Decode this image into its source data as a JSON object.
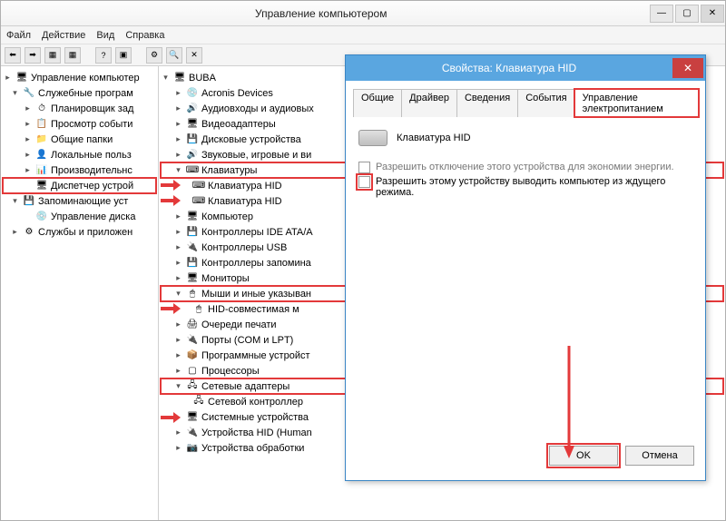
{
  "window": {
    "title": "Управление компьютером",
    "btn_min": "—",
    "btn_max": "▢",
    "btn_close": "✕"
  },
  "menu": {
    "file": "Файл",
    "action": "Действие",
    "view": "Вид",
    "help": "Справка"
  },
  "left_tree": {
    "root": "Управление компьютер",
    "n1": "Служебные програм",
    "n1a": "Планировщик зад",
    "n1b": "Просмотр событи",
    "n1c": "Общие папки",
    "n1d": "Локальные польз",
    "n1e": "Производительнс",
    "n1f": "Диспетчер устрой",
    "n2": "Запоминающие уст",
    "n2a": "Управление диска",
    "n3": "Службы и приложен"
  },
  "mid_tree": {
    "root": "BUBA",
    "a": "Acronis Devices",
    "b": "Аудиовходы и аудиовых",
    "c": "Видеоадаптеры",
    "d": "Дисковые устройства",
    "e": "Звуковые, игровые и ви",
    "f": "Клавиатуры",
    "f1": "Клавиатура HID",
    "f2": "Клавиатура HID",
    "g": "Компьютер",
    "h": "Контроллеры IDE ATA/A",
    "i": "Контроллеры USB",
    "j": "Контроллеры запомина",
    "k": "Мониторы",
    "l": "Мыши и иные указыван",
    "l1": "HID-совместимая м",
    "m": "Очереди печати",
    "n": "Порты (COM и LPT)",
    "o": "Программные устройст",
    "p": "Процессоры",
    "q": "Сетевые адаптеры",
    "q1": "Сетевой контроллер",
    "r": "Системные устройства",
    "s": "Устройства HID (Human",
    "t": "Устройства обработки"
  },
  "dialog": {
    "title": "Свойства: Клавиатура HID",
    "close": "✕",
    "tabs": {
      "t1": "Общие",
      "t2": "Драйвер",
      "t3": "Сведения",
      "t4": "События",
      "t5": "Управление электропитанием"
    },
    "device": "Клавиатура HID",
    "opt1": "Разрешить отключение этого устройства для экономии энергии.",
    "opt2": "Разрешить этому устройству выводить компьютер из ждущего режима.",
    "ok": "OK",
    "cancel": "Отмена"
  }
}
